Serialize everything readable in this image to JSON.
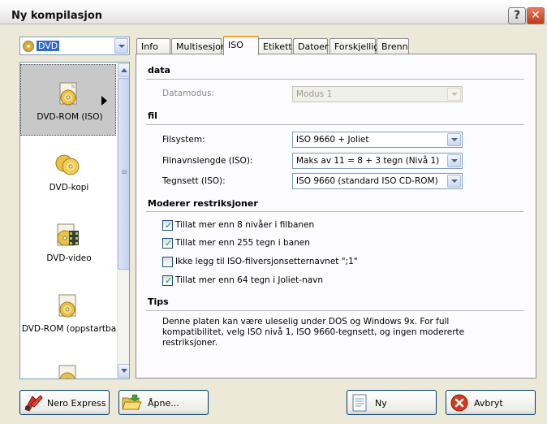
{
  "window": {
    "title": "Ny kompilasjon",
    "help_label": "?",
    "close_label": "✕"
  },
  "media_combo": {
    "value": "DVD",
    "icon": "dvd-disc-icon"
  },
  "list": {
    "items": [
      {
        "label": "DVD-ROM (ISO)",
        "selected": true,
        "icon": "dvd-rom-icon"
      },
      {
        "label": "DVD-kopi",
        "selected": false,
        "icon": "dvd-copy-icon"
      },
      {
        "label": "DVD-video",
        "selected": false,
        "icon": "dvd-video-icon"
      },
      {
        "label": "DVD-ROM (oppstartba",
        "selected": false,
        "icon": "dvd-boot-icon"
      }
    ]
  },
  "tabs": [
    {
      "label": "Info",
      "active": false
    },
    {
      "label": "Multisesjon",
      "active": false
    },
    {
      "label": "ISO",
      "active": true
    },
    {
      "label": "Etikett",
      "active": false
    },
    {
      "label": "Datoer",
      "active": false
    },
    {
      "label": "Forskjellig",
      "active": false
    },
    {
      "label": "Brenn",
      "active": false
    }
  ],
  "iso": {
    "section_data": "data",
    "datamodus_label": "Datamodus:",
    "datamodus_value": "Modus 1",
    "section_fil": "fil",
    "filsystem_label": "Filsystem:",
    "filsystem_value": "ISO 9660 + Joliet",
    "filnavn_label": "Filnavnslengde (ISO):",
    "filnavn_value": "Maks av 11 = 8 + 3 tegn (Nivå 1)",
    "tegnsett_label": "Tegnsett (ISO):",
    "tegnsett_value": "ISO 9660 (standard ISO CD-ROM)",
    "section_restr": "Moderer restriksjoner",
    "checkboxes": [
      {
        "label": "Tillat mer enn 8 nivåer i filbanen",
        "checked": true
      },
      {
        "label": "Tillat mer enn 255 tegn i banen",
        "checked": true
      },
      {
        "label": "Ikke legg til ISO-filversjonsetternavnet \";1\"",
        "checked": false
      },
      {
        "label": "Tillat mer enn 64 tegn i Joliet-navn",
        "checked": true
      }
    ],
    "section_tips": "Tips",
    "tips_text": "Denne platen kan være uleselig under DOS og Windows 9x. For full kompatibilitet, velg ISO nivå 1, ISO 9660-tegnsett, og ingen modererte restriksjoner."
  },
  "buttons": {
    "nero_express": "Nero Express",
    "open": "Åpne...",
    "new": "Ny",
    "cancel": "Avbryt"
  },
  "colors": {
    "accent_tab": "#f1a034",
    "selection": "#316ac5",
    "check": "#21a121",
    "cancel_red": "#d43a1e"
  }
}
